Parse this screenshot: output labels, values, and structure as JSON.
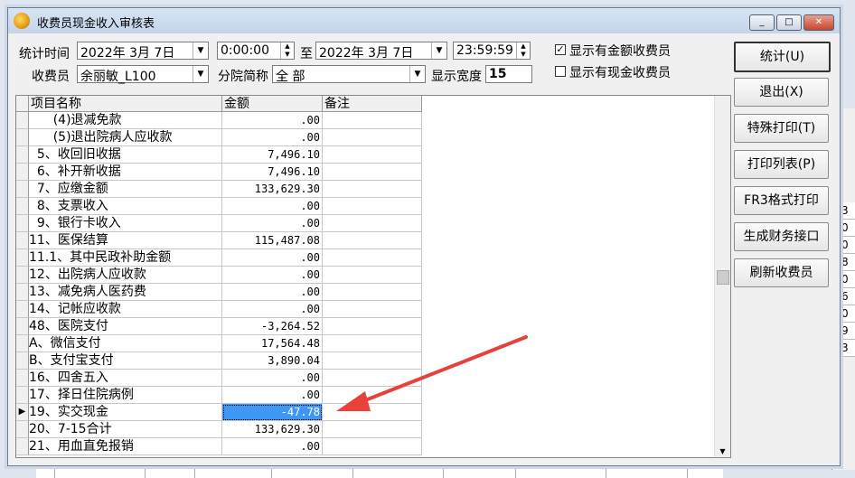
{
  "window": {
    "title": "收费员现金收入审核表",
    "min": "_",
    "max": "□",
    "close": "✕"
  },
  "filters": {
    "time_label": "统计时间",
    "start_date": "2022年 3月 7日",
    "start_time": "0:00:00",
    "to_label": "至",
    "end_date": "2022年 3月 7日",
    "end_time": "23:59:59",
    "cashier_label": "收费员",
    "cashier_value": "余丽敏_L100",
    "branch_label": "分院简称",
    "branch_value": "全 部",
    "width_label": "显示宽度",
    "width_value": "15",
    "show_amount_label": "显示有金额收费员",
    "show_amount_checked": "✓",
    "show_cash_label": "显示有现金收费员"
  },
  "table": {
    "headers": [
      "项目名称",
      "金额",
      "备注"
    ],
    "rows": [
      {
        "name": "      (4)退减免款",
        "amount": ".00",
        "note": ""
      },
      {
        "name": "      (5)退出院病人应收款",
        "amount": ".00",
        "note": ""
      },
      {
        "name": "  5、收回旧收据",
        "amount": "7,496.10",
        "note": ""
      },
      {
        "name": "  6、补开新收据",
        "amount": "7,496.10",
        "note": ""
      },
      {
        "name": "  7、应缴金额",
        "amount": "133,629.30",
        "note": ""
      },
      {
        "name": "  8、支票收入",
        "amount": ".00",
        "note": ""
      },
      {
        "name": "  9、银行卡收入",
        "amount": ".00",
        "note": ""
      },
      {
        "name": "11、医保结算",
        "amount": "115,487.08",
        "note": ""
      },
      {
        "name": "11.1、其中民政补助金额",
        "amount": ".00",
        "note": ""
      },
      {
        "name": "12、出院病人应收款",
        "amount": ".00",
        "note": ""
      },
      {
        "name": "13、减免病人医药费",
        "amount": ".00",
        "note": ""
      },
      {
        "name": "14、记帐应收款",
        "amount": ".00",
        "note": ""
      },
      {
        "name": "48、医院支付",
        "amount": "-3,264.52",
        "note": ""
      },
      {
        "name": "A、微信支付",
        "amount": "17,564.48",
        "note": ""
      },
      {
        "name": "B、支付宝支付",
        "amount": "3,890.04",
        "note": ""
      },
      {
        "name": "16、四舍五入",
        "amount": ".00",
        "note": ""
      },
      {
        "name": "17、择日住院病例",
        "amount": ".00",
        "note": ""
      },
      {
        "name": "19、实交现金",
        "amount": "-47.78",
        "note": ""
      },
      {
        "name": "20、7-15合计",
        "amount": "133,629.30",
        "note": ""
      },
      {
        "name": "21、用血直免报销",
        "amount": ".00",
        "note": ""
      }
    ],
    "selected_row": 17,
    "current_row_marker": "▶"
  },
  "buttons": [
    "统计(U)",
    "退出(X)",
    "特殊打印(T)",
    "打印列表(P)",
    "FR3格式打印",
    "生成财务接口",
    "刷新收费员"
  ],
  "background_cells": [
    "3",
    "0",
    "0",
    "8",
    "0",
    "6",
    "0",
    "9",
    "3"
  ],
  "colors": {
    "selection": "#3e96f7",
    "arrow": "#e8413a"
  }
}
